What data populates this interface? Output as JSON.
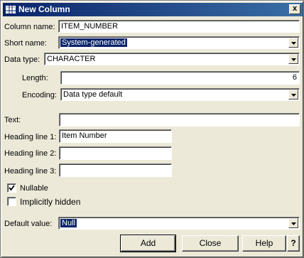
{
  "window": {
    "title": "New Column",
    "close_label": "x"
  },
  "form": {
    "column_name": {
      "label": "Column name:",
      "value": "ITEM_NUMBER"
    },
    "short_name": {
      "label": "Short name:",
      "value": "System-generated"
    },
    "data_type": {
      "label": "Data type:",
      "value": "CHARACTER"
    },
    "length": {
      "label": "Length:",
      "value": "6"
    },
    "encoding": {
      "label": "Encoding:",
      "value": "Data type default"
    },
    "text": {
      "label": "Text:",
      "value": ""
    },
    "heading1": {
      "label": "Heading line 1:",
      "value": "Item Number"
    },
    "heading2": {
      "label": "Heading line 2:",
      "value": ""
    },
    "heading3": {
      "label": "Heading line 3:",
      "value": ""
    },
    "nullable": {
      "label": "Nullable",
      "checked": true
    },
    "implicitly_hidden": {
      "label": "Implicitly hidden",
      "checked": false
    },
    "default_value": {
      "label": "Default value:",
      "value": "Null"
    }
  },
  "buttons": {
    "add": "Add",
    "close": "Close",
    "help": "Help",
    "whats_this": "?"
  },
  "colors": {
    "titlebar": "#0a246a",
    "dialog_bg": "#ece9d8",
    "selection": "#0a246a"
  }
}
